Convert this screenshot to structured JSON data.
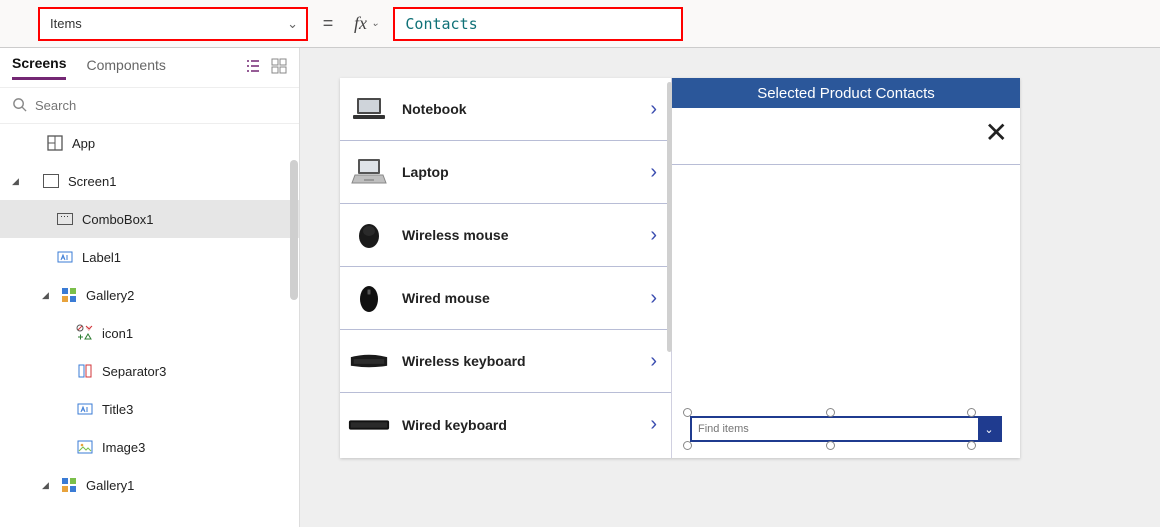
{
  "formulaBar": {
    "property": "Items",
    "equals": "=",
    "fx": "fx",
    "formula": "Contacts"
  },
  "leftPanel": {
    "tabs": {
      "screens": "Screens",
      "components": "Components"
    },
    "searchPlaceholder": "Search",
    "tree": {
      "app": "App",
      "screen1": "Screen1",
      "combobox1": "ComboBox1",
      "label1": "Label1",
      "gallery2": "Gallery2",
      "icon1": "icon1",
      "separator3": "Separator3",
      "title3": "Title3",
      "image3": "Image3",
      "gallery1": "Gallery1"
    }
  },
  "canvas": {
    "products": [
      "Notebook",
      "Laptop",
      "Wireless mouse",
      "Wired mouse",
      "Wireless keyboard",
      "Wired keyboard"
    ],
    "headerTitle": "Selected Product Contacts",
    "comboPlaceholder": "Find items"
  }
}
